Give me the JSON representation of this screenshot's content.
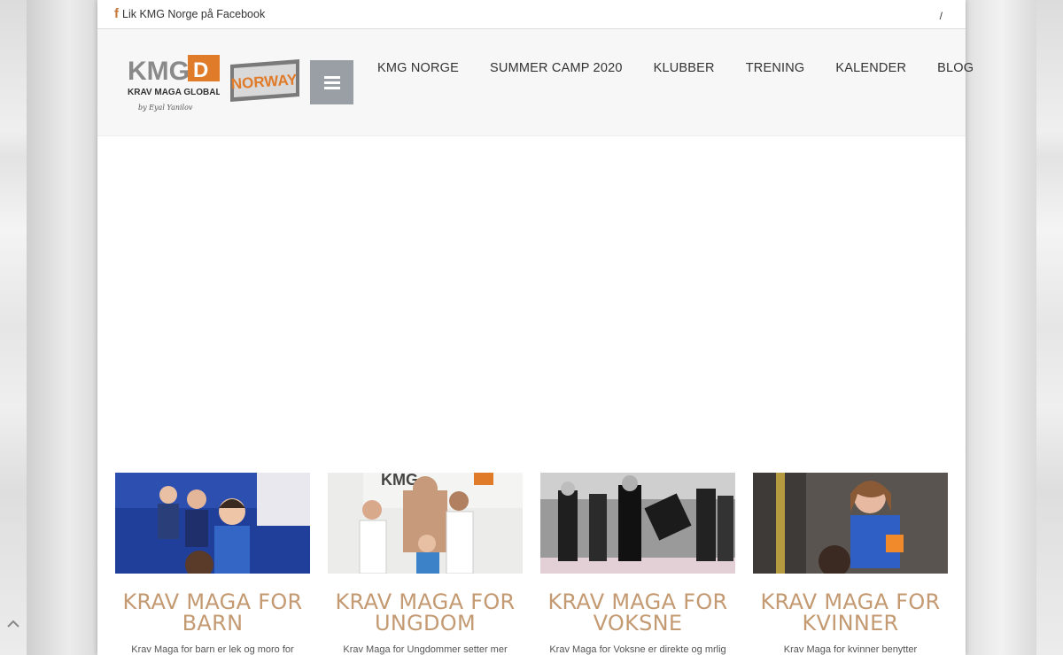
{
  "topbar": {
    "facebook_icon": "f",
    "facebook_label": "Lik KMG Norge på Facebook",
    "slash": "/"
  },
  "logo": {
    "main": "KMG",
    "sub": "KRAV MAGA GLOBAL",
    "by": "by Eyal Yanilov",
    "country": "NORWAY"
  },
  "nav": {
    "items": [
      "KMG NORGE",
      "SUMMER CAMP 2020",
      "KLUBBER",
      "TRENING",
      "KALENDER",
      "BLOG"
    ]
  },
  "cards": [
    {
      "title_1": "KRAV MAGA FOR",
      "title_2": "BARN",
      "text": "Krav Maga for barn er lek og moro for"
    },
    {
      "title_1": "KRAV MAGA FOR",
      "title_2": "UNGDOM",
      "text": "Krav Maga for Ungdommer setter mer"
    },
    {
      "title_1": "KRAV MAGA FOR",
      "title_2": "VOKSNE",
      "text": "Krav Maga for Voksne er direkte og mrlig"
    },
    {
      "title_1": "KRAV MAGA FOR",
      "title_2": "KVINNER",
      "text": "Krav Maga for kvinner benytter"
    }
  ],
  "colors": {
    "accent": "#c49a72",
    "logo_orange": "#e07b2a",
    "menu_button": "#9a9ea5"
  }
}
